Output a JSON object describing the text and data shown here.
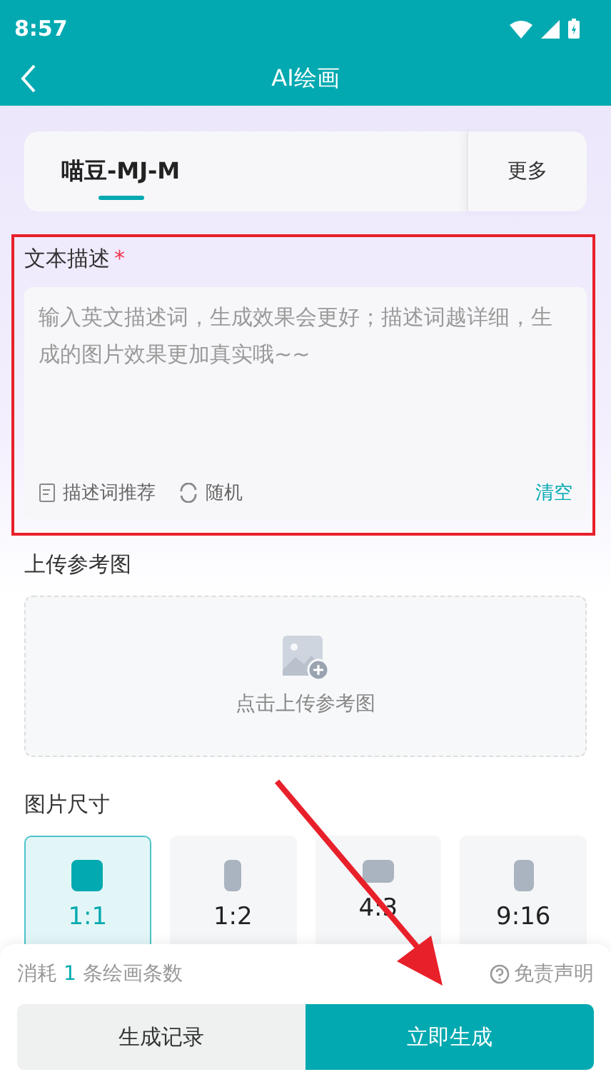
{
  "status_bar": {
    "time": "8:57"
  },
  "header": {
    "title": "AI绘画"
  },
  "model_tabs": {
    "items": [
      {
        "label": "喵豆-MJ-M",
        "selected": true
      }
    ],
    "more": "更多"
  },
  "prompt": {
    "label": "文本描述",
    "required_mark": "*",
    "placeholder": "输入英文描述词，生成效果会更好；描述词越详细，生成的图片效果更加真实哦~~",
    "recommend": "描述词推荐",
    "random": "随机",
    "clear": "清空"
  },
  "upload": {
    "label": "上传参考图",
    "hint": "点击上传参考图"
  },
  "size": {
    "label": "图片尺寸",
    "options": [
      {
        "ratio": "1:1",
        "kind": "square",
        "selected": true
      },
      {
        "ratio": "1:2",
        "kind": "tall",
        "selected": false
      },
      {
        "ratio": "4:3",
        "kind": "wide",
        "selected": false
      },
      {
        "ratio": "9:16",
        "kind": "portrait",
        "selected": false
      }
    ]
  },
  "footer": {
    "cost_prefix": "消耗",
    "cost_count": "1",
    "cost_suffix": "条绘画条数",
    "disclaimer": "免责声明",
    "history_button": "生成记录",
    "generate_button": "立即生成"
  },
  "annotations": {
    "highlight_frame": true,
    "arrow": true
  }
}
